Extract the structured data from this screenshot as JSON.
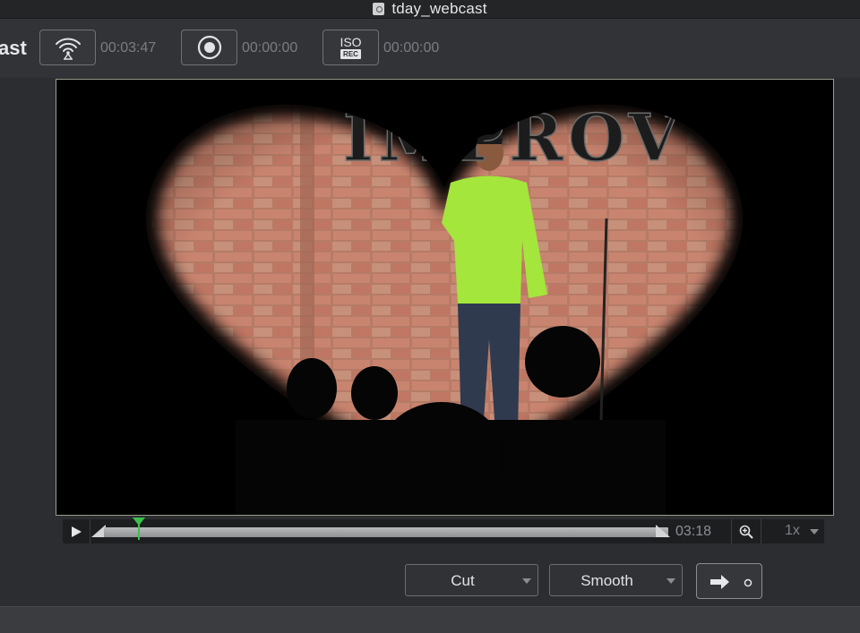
{
  "window": {
    "title": "tday_webcast",
    "title_icon": "document-icon"
  },
  "toolbar": {
    "brand_partial": "ast",
    "stream": {
      "icon": "broadcast-icon",
      "time": "00:03:47"
    },
    "record": {
      "icon": "record-icon",
      "time": "00:00:00"
    },
    "iso_record": {
      "icon_top": "ISO",
      "icon_bottom": "REC",
      "time": "00:00:00"
    }
  },
  "video": {
    "sign_text": "IMPROV"
  },
  "scrubber": {
    "play_icon": "play-icon",
    "duration": "03:18",
    "zoom_icon": "zoom-in-icon",
    "speed": "1x",
    "playhead_progress": 0.06
  },
  "transition": {
    "type": "Cut",
    "mode": "Smooth",
    "go_icon": "arrow-right-icon"
  },
  "colors": {
    "playhead": "#39c24a",
    "shirt": "#a4e63c"
  }
}
